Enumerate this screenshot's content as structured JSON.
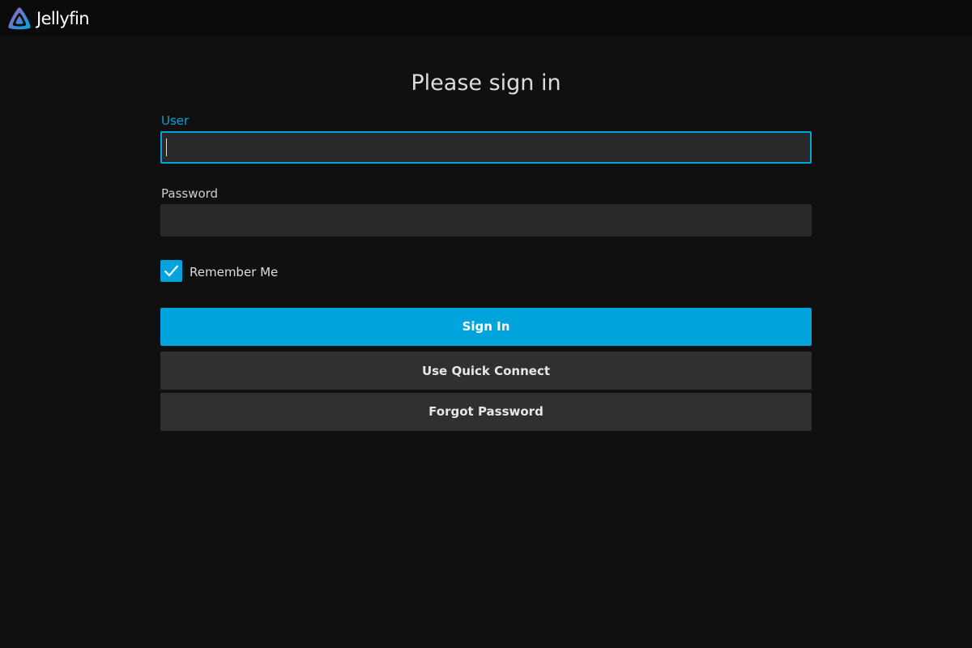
{
  "header": {
    "logo_text": "Jellyfin",
    "logo_icon": "jellyfin-logo-icon"
  },
  "login": {
    "title": "Please sign in",
    "user_label": "User",
    "user_value": "",
    "password_label": "Password",
    "password_value": "",
    "remember_me_label": "Remember Me",
    "remember_me_checked": true,
    "sign_in_label": "Sign In",
    "quick_connect_label": "Use Quick Connect",
    "forgot_password_label": "Forgot Password"
  },
  "colors": {
    "accent": "#00a4dc",
    "background": "#101010",
    "header": "#0b0b0b",
    "input": "#292929",
    "secondary_button": "#303030"
  }
}
